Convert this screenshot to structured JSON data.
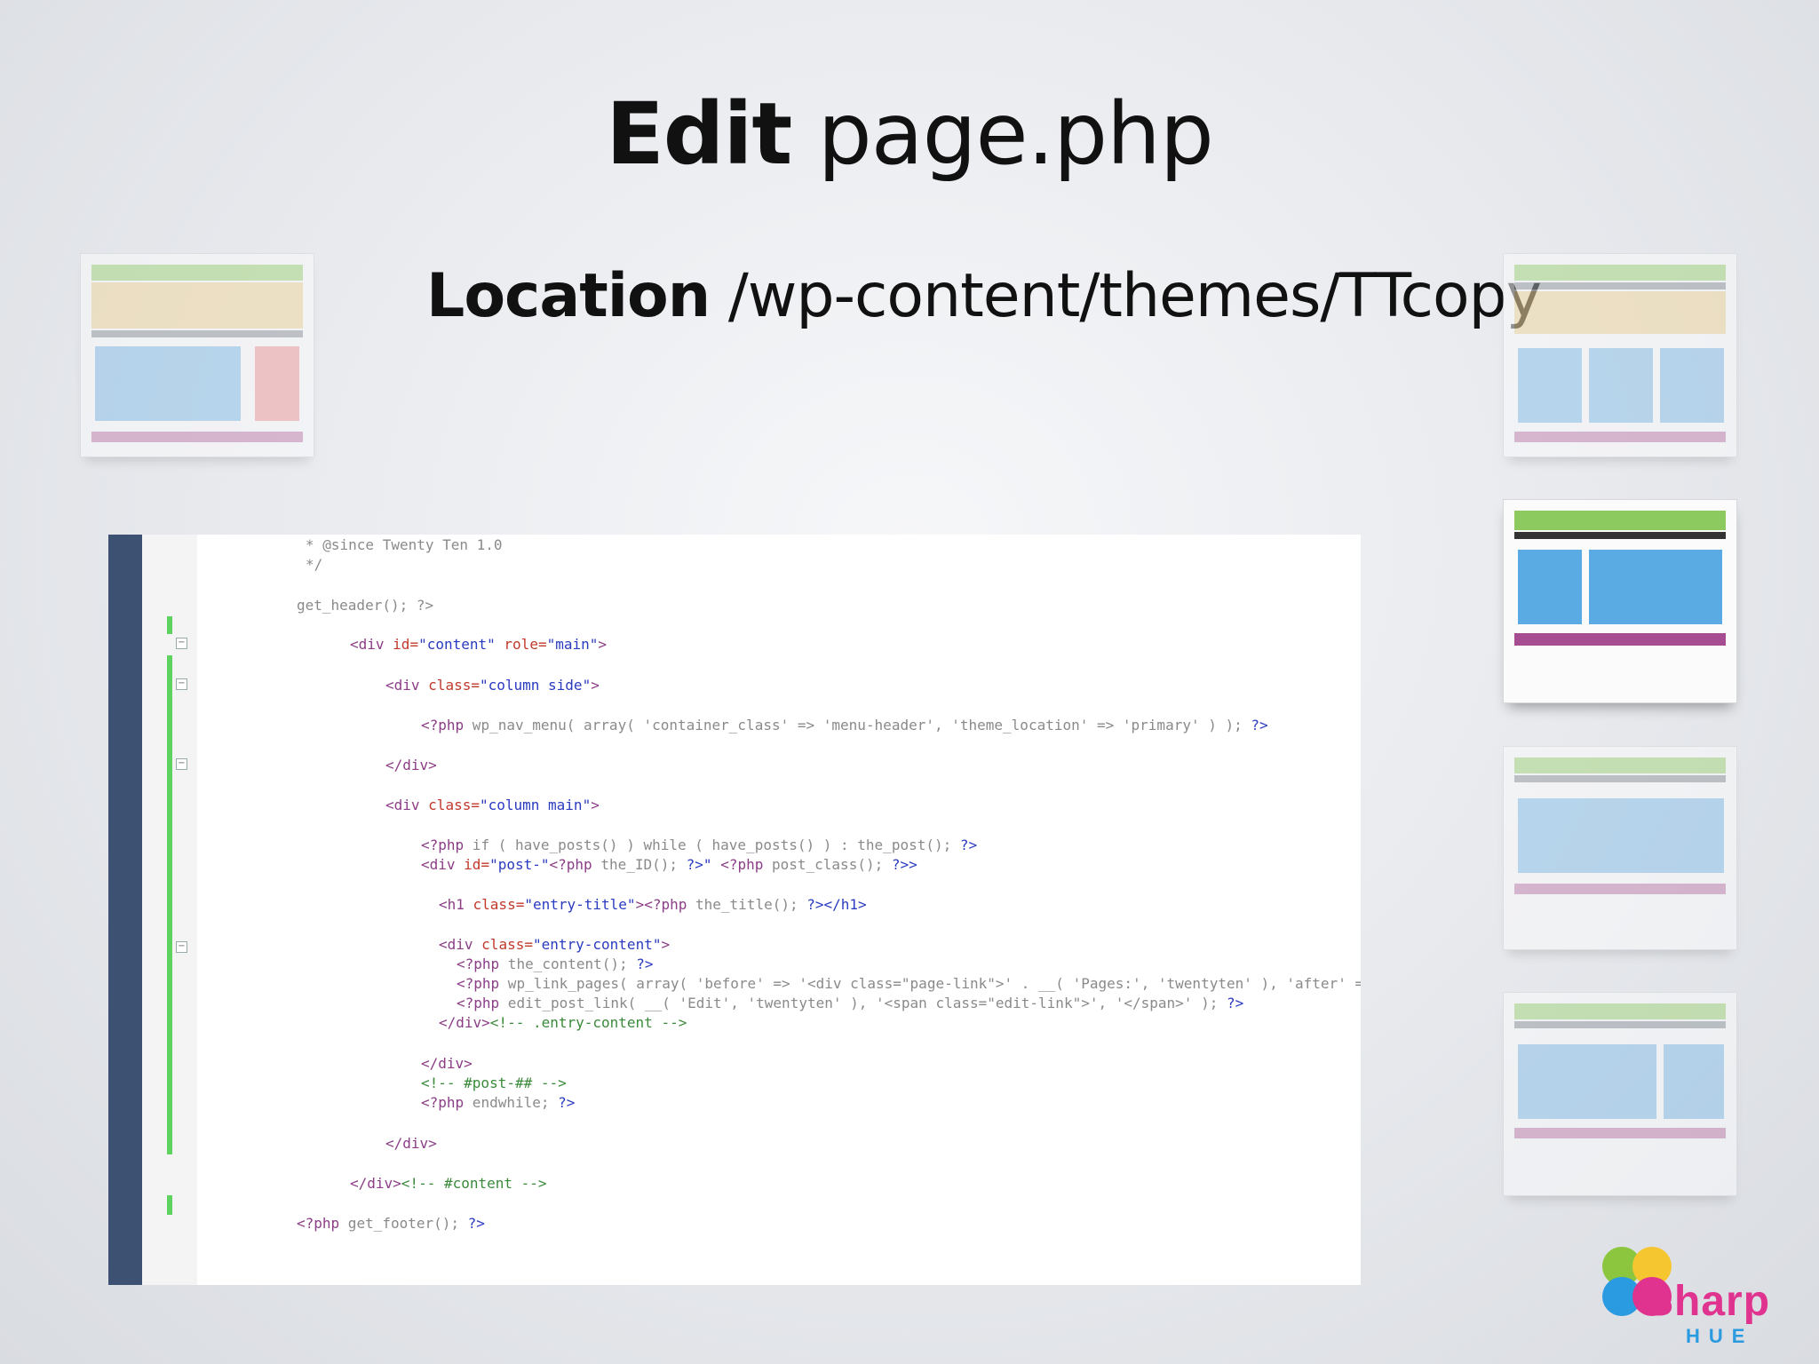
{
  "title": {
    "bold": "Edit",
    "rest": "page.php"
  },
  "subtitle": {
    "bold": "Location",
    "rest": "/wp-content/themes/TTcopy"
  },
  "code": {
    "line1": "* @since Twenty Ten 1.0",
    "line2": "*/",
    "line3": "get_header(); ?>",
    "line4_open": "<div ",
    "line4_a1": "id=",
    "line4_v1": "\"content\"",
    "line4_a2": " role=",
    "line4_v2": "\"main\"",
    "line4_close": ">",
    "line5_open": "<div ",
    "line5_a1": "class=",
    "line5_v1": "\"column side\"",
    "line5_close": ">",
    "line6_php": "<?php",
    "line6_body": " wp_nav_menu( array( 'container_class' => 'menu-header', 'theme_location' => 'primary' ) ); ",
    "line6_end": "?>",
    "line7": "</div>",
    "line8_open": "<div ",
    "line8_a1": "class=",
    "line8_v1": "\"column main\"",
    "line8_close": ">",
    "line9_php": "<?php",
    "line9_body": " if ( have_posts() ) while ( have_posts() ) : the_post(); ",
    "line9_end": "?>",
    "line10_open": "<div ",
    "line10_a1": "id=",
    "line10_v1": "\"post-\"",
    "line10_php": "<?php",
    "line10_body": " the_ID(); ",
    "line10_end": "?>\"",
    "line10_php2": " <?php",
    "line10_body2": " post_class(); ",
    "line10_end2": "?>>",
    "line11_open": "<h1 ",
    "line11_a1": "class=",
    "line11_v1": "\"entry-title\"",
    "line11_gt": ">",
    "line11_php": "<?php",
    "line11_body": " the_title(); ",
    "line11_end": "?></h1>",
    "line12_open": "<div ",
    "line12_a1": "class=",
    "line12_v1": "\"entry-content\"",
    "line12_close": ">",
    "line13_php": "<?php",
    "line13_body": " the_content(); ",
    "line13_end": "?>",
    "line14_php": "<?php",
    "line14_body": " wp_link_pages( array( 'before' => '<div class=\"page-link\">' . __( 'Pages:', 'twentyten' ), 'after' => '</div>'",
    "line15_php": "<?php",
    "line15_body": " edit_post_link( __( 'Edit', 'twentyten' ), '<span class=\"edit-link\">', '</span>' ); ",
    "line15_end": "?>",
    "line16_tag": "</div>",
    "line16_cm": "<!-- .entry-content -->",
    "line17": "</div>",
    "line18": "<!-- #post-## -->",
    "line19_php": "<?php",
    "line19_body": " endwhile; ",
    "line19_end": "?>",
    "line20": "</div>",
    "line21_tag": "</div>",
    "line21_cm": "<!-- #content -->",
    "line22_php": "<?php",
    "line22_body": " get_footer(); ",
    "line22_end": "?>"
  },
  "logo": {
    "word": "Sharp",
    "sub": "HUE"
  },
  "colors": {
    "header_green": "#a8d784",
    "banner_yellow": "#f1d9a3",
    "content_blue": "#8fc3ea",
    "sidebar_red": "#f0a3a3",
    "footer_purple": "#c78ab4",
    "editor_gutter": "#3d5272",
    "change_bar": "#5fd35f"
  }
}
